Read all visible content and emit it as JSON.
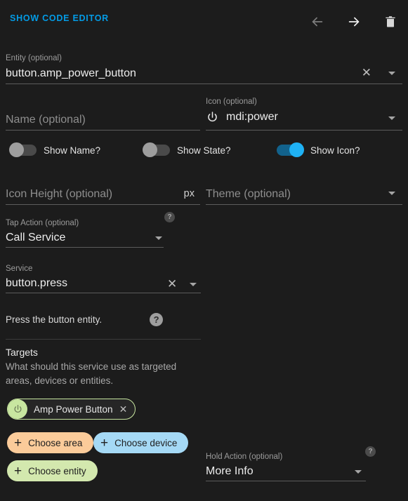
{
  "header": {
    "code_editor_label": "SHOW CODE EDITOR",
    "back_icon": "arrow-left-icon",
    "forward_icon": "arrow-right-icon",
    "delete_icon": "trash-icon",
    "accent_color": "#039be5"
  },
  "entity_field": {
    "label": "Entity (optional)",
    "value": "button.amp_power_button",
    "clear_glyph": "✕"
  },
  "name_field": {
    "label": "Name (optional)",
    "placeholder": "Name (optional)",
    "value": ""
  },
  "icon_field": {
    "label": "Icon (optional)",
    "value": "mdi:power",
    "glyph_name": "power-icon"
  },
  "toggles": [
    {
      "label": "Show Name?",
      "on": false,
      "name": "show-name"
    },
    {
      "label": "Show State?",
      "on": false,
      "name": "show-state"
    },
    {
      "label": "Show Icon?",
      "on": true,
      "name": "show-icon"
    }
  ],
  "icon_height_field": {
    "label": "Icon Height (optional)",
    "placeholder": "Icon Height (optional)",
    "value": "",
    "suffix": "px"
  },
  "theme_field": {
    "label": "Theme (optional)",
    "placeholder": "Theme (optional)",
    "value": ""
  },
  "tap_action": {
    "label": "Tap Action (optional)",
    "value": "Call Service",
    "help_glyph": "?"
  },
  "service_field": {
    "label": "Service",
    "value": "button.press",
    "clear_glyph": "✕"
  },
  "service_description": {
    "text": "Press the button entity.",
    "help_glyph": "?"
  },
  "targets": {
    "title": "Targets",
    "description": "What should this service use as targeted areas, devices or entities.",
    "entity_chip": {
      "label": "Amp Power Button",
      "remove_glyph": "✕",
      "avatar_icon": "power-icon",
      "color": "#c8e6a0"
    },
    "add_chips": [
      {
        "label": "Choose area",
        "color": "#fbcb9a",
        "name": "choose-area"
      },
      {
        "label": "Choose device",
        "color": "#a5d9f5",
        "name": "choose-device"
      },
      {
        "label": "Choose entity",
        "color": "#d3e8ae",
        "name": "choose-entity"
      }
    ],
    "plus_glyph": "+"
  },
  "hold_action": {
    "label": "Hold Action (optional)",
    "value": "More Info",
    "help_glyph": "?"
  }
}
